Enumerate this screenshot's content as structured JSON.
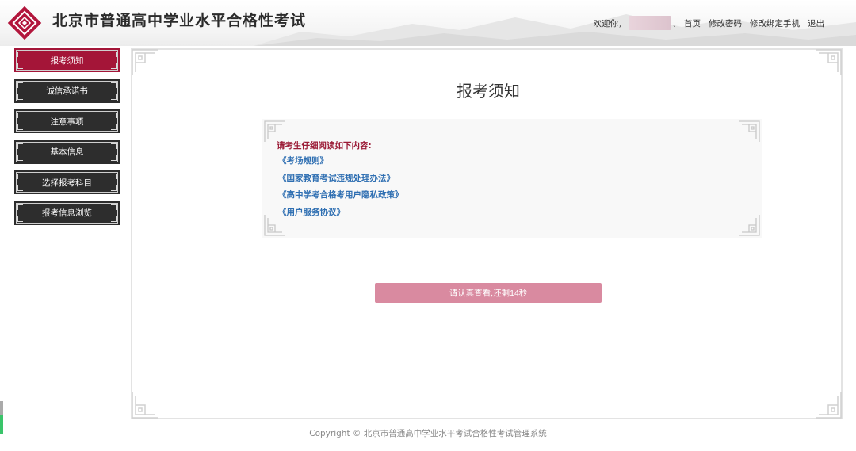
{
  "header": {
    "title": "北京市普通高中学业水平合格性考试",
    "welcome": "欢迎你，",
    "separator": "、",
    "nav": [
      "首页",
      "修改密码",
      "修改绑定手机",
      "退出"
    ]
  },
  "sidebar": {
    "items": [
      {
        "label": "报考须知",
        "active": true
      },
      {
        "label": "诚信承诺书",
        "active": false
      },
      {
        "label": "注意事项",
        "active": false
      },
      {
        "label": "基本信息",
        "active": false
      },
      {
        "label": "选择报考科目",
        "active": false
      },
      {
        "label": "报考信息浏览",
        "active": false
      }
    ]
  },
  "main": {
    "title": "报考须知",
    "notice_heading": "请考生仔细阅读如下内容:",
    "documents": [
      "《考场规则》",
      "《国家教育考试违规处理办法》",
      "《高中学考合格考用户隐私政策》",
      "《用户服务协议》"
    ],
    "countdown_label": "请认真查看,还剩14秒"
  },
  "footer": {
    "copyright": "Copyright © 北京市普通高中学业水平考试合格性考试管理系统"
  },
  "colors": {
    "accent": "#a41538",
    "menu_bg": "#2d2d2d",
    "link": "#2f6fb2",
    "button_disabled": "#d98aa0"
  },
  "icons": {
    "logo": "exam-logo-icon",
    "corner": "fret-corner-ornament"
  }
}
